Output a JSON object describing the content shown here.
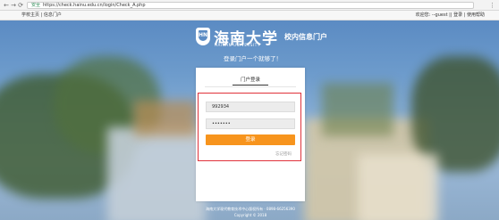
{
  "browser": {
    "secure_label": "安全",
    "url": "https://check.hainu.edu.cn/login/Check_A.php",
    "back_icon": "arrow-left-icon",
    "forward_icon": "arrow-right-icon",
    "reload_icon": "reload-icon",
    "menu_icon": "kebab-menu-icon"
  },
  "topbar": {
    "home_link": "学校主页",
    "separator": "|",
    "portal_link": "信息门户",
    "greeting": "欢迎您: --guest",
    "login_link": "登录",
    "help_link": "使用帮助"
  },
  "header": {
    "university_name": "海南大学",
    "university_name_en": "HAINAN UNIVERSITY",
    "portal_name": "校内信息门户",
    "welcome_text": "登录门户一个就够了！"
  },
  "login": {
    "tab_label": "门户登录",
    "username_value": "992934",
    "password_value": "•••••••",
    "submit_label": "登录",
    "forgot_link": "忘记密码"
  },
  "footer": {
    "line1": "海南大学现代教育技术中心版权所有 · 0898-66256390",
    "line2": "Copyright © 2018"
  },
  "colors": {
    "accent": "#f7941d",
    "highlight_border": "#e0313a",
    "sky": "#6e9ccc"
  }
}
